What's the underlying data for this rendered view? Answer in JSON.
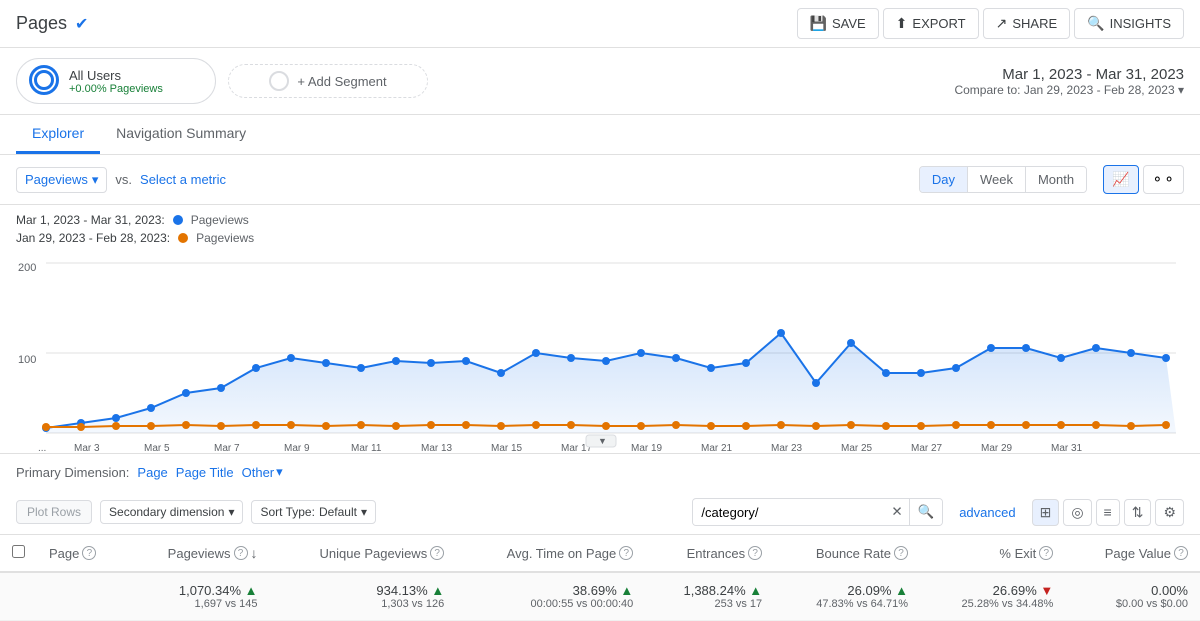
{
  "topbar": {
    "title": "Pages",
    "verified": true,
    "actions": [
      {
        "id": "save",
        "label": "SAVE",
        "icon": "💾"
      },
      {
        "id": "export",
        "label": "EXPORT",
        "icon": "⬆"
      },
      {
        "id": "share",
        "label": "SHARE",
        "icon": "↗"
      },
      {
        "id": "insights",
        "label": "INSIGHTS",
        "icon": "🔍"
      }
    ]
  },
  "segments": {
    "current": {
      "name": "All Users",
      "sub": "+0.00% Pageviews"
    },
    "add_label": "+ Add Segment"
  },
  "daterange": {
    "main": "Mar 1, 2023 - Mar 31, 2023",
    "compare_label": "Compare to:",
    "compare": "Jan 29, 2023 - Feb 28, 2023"
  },
  "tabs": [
    {
      "id": "explorer",
      "label": "Explorer",
      "active": true
    },
    {
      "id": "nav-summary",
      "label": "Navigation Summary",
      "active": false
    }
  ],
  "chart_controls": {
    "metric_label": "Pageviews",
    "vs_label": "vs.",
    "select_metric": "Select a metric",
    "time_buttons": [
      "Day",
      "Week",
      "Month"
    ],
    "active_time": "Day"
  },
  "legend": {
    "row1_period": "Mar 1, 2023 - Mar 31, 2023:",
    "row1_label": "Pageviews",
    "row1_color": "#1a73e8",
    "row2_period": "Jan 29, 2023 - Feb 28, 2023:",
    "row2_label": "Pageviews",
    "row2_color": "#e37400"
  },
  "chart": {
    "y_labels": [
      "200",
      "100"
    ],
    "x_labels": [
      "...",
      "Mar 3",
      "Mar 5",
      "Mar 7",
      "Mar 9",
      "Mar 11",
      "Mar 13",
      "Mar 15",
      "Mar 17",
      "Mar 19",
      "Mar 21",
      "Mar 23",
      "Mar 25",
      "Mar 27",
      "Mar 29",
      "Mar 31"
    ]
  },
  "primary_dimension": {
    "label": "Primary Dimension:",
    "options": [
      {
        "id": "page",
        "label": "Page",
        "active": true
      },
      {
        "id": "page-title",
        "label": "Page Title",
        "active": false
      },
      {
        "id": "other",
        "label": "Other",
        "dropdown": true
      }
    ]
  },
  "toolbar": {
    "plot_rows_label": "Plot Rows",
    "secondary_dim_label": "Secondary dimension",
    "sort_type_label": "Sort Type:",
    "sort_default": "Default",
    "search_value": "/category/",
    "advanced_label": "advanced"
  },
  "table": {
    "columns": [
      {
        "id": "checkbox",
        "label": ""
      },
      {
        "id": "page",
        "label": "Page",
        "has_help": true
      },
      {
        "id": "pageviews",
        "label": "Pageviews",
        "has_help": true,
        "has_sort": true
      },
      {
        "id": "unique_pageviews",
        "label": "Unique Pageviews",
        "has_help": true
      },
      {
        "id": "avg_time",
        "label": "Avg. Time on Page",
        "has_help": true
      },
      {
        "id": "entrances",
        "label": "Entrances",
        "has_help": true
      },
      {
        "id": "bounce_rate",
        "label": "Bounce Rate",
        "has_help": true
      },
      {
        "id": "pct_exit",
        "label": "% Exit",
        "has_help": true
      },
      {
        "id": "page_value",
        "label": "Page Value",
        "has_help": true
      }
    ],
    "total_row": {
      "pageviews_pct": "1,070.34%",
      "pageviews_dir": "up",
      "pageviews_sub": "1,697 vs 145",
      "unique_pct": "934.13%",
      "unique_dir": "up",
      "unique_sub": "1,303 vs 126",
      "avg_time_pct": "38.69%",
      "avg_time_dir": "up",
      "avg_time_sub": "00:00:55 vs 00:00:40",
      "entrances_pct": "1,388.24%",
      "entrances_dir": "up",
      "entrances_sub": "253 vs 17",
      "bounce_rate_pct": "26.09%",
      "bounce_rate_dir": "up",
      "bounce_rate_sub": "47.83% vs 64.71%",
      "pct_exit_pct": "26.69%",
      "pct_exit_dir": "down",
      "pct_exit_sub": "25.28% vs 34.48%",
      "page_value_pct": "0.00%",
      "page_value_dir": "neutral",
      "page_value_sub": "$0.00 vs $0.00"
    }
  }
}
